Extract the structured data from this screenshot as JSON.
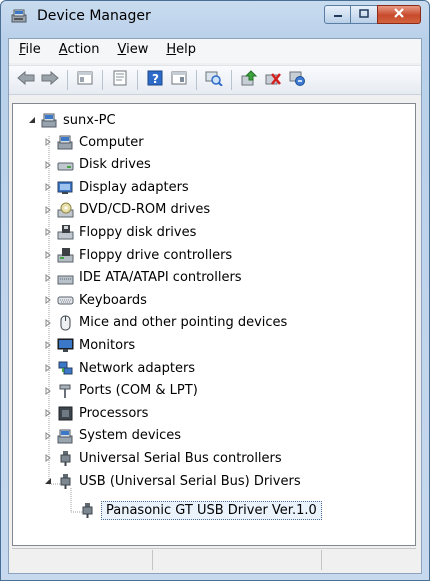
{
  "window": {
    "title": "Device Manager"
  },
  "menu": [
    "File",
    "Action",
    "View",
    "Help"
  ],
  "menu_access_keys": [
    "F",
    "A",
    "V",
    "H"
  ],
  "toolbar": {
    "buttons": [
      "back-icon",
      "forward-icon",
      "show-hide-tree-icon",
      "properties-icon",
      "help-icon",
      "view-icon",
      "scan-hardware-icon",
      "update-driver-icon",
      "disable-device-icon",
      "uninstall-device-icon"
    ]
  },
  "tree": {
    "root": "sunx-PC",
    "categories": [
      {
        "label": "Computer",
        "icon": "computer-icon"
      },
      {
        "label": "Disk drives",
        "icon": "disk-drive-icon"
      },
      {
        "label": "Display adapters",
        "icon": "display-adapter-icon"
      },
      {
        "label": "DVD/CD-ROM drives",
        "icon": "dvd-drive-icon"
      },
      {
        "label": "Floppy disk drives",
        "icon": "floppy-disk-icon"
      },
      {
        "label": "Floppy drive controllers",
        "icon": "floppy-controller-icon"
      },
      {
        "label": "IDE ATA/ATAPI controllers",
        "icon": "ide-controller-icon"
      },
      {
        "label": "Keyboards",
        "icon": "keyboard-icon"
      },
      {
        "label": "Mice and other pointing devices",
        "icon": "mouse-icon"
      },
      {
        "label": "Monitors",
        "icon": "monitor-icon"
      },
      {
        "label": "Network adapters",
        "icon": "network-adapter-icon"
      },
      {
        "label": "Ports (COM & LPT)",
        "icon": "port-icon"
      },
      {
        "label": "Processors",
        "icon": "processor-icon"
      },
      {
        "label": "System devices",
        "icon": "system-devices-icon"
      },
      {
        "label": "Universal Serial Bus controllers",
        "icon": "usb-icon"
      },
      {
        "label": "USB (Universal Serial Bus) Drivers",
        "icon": "usb-icon"
      }
    ],
    "child": {
      "label": "Panasonic GT USB Driver Ver.1.0",
      "icon": "usb-icon"
    }
  },
  "colors": {
    "title_bar": "#b9d0ea",
    "close_button": "#c74a2c",
    "tree_bg": "#ffffff"
  }
}
